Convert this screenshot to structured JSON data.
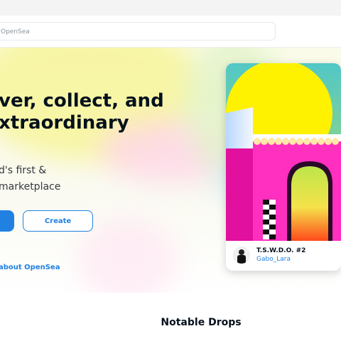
{
  "search": {
    "placeholder": "OpenSea"
  },
  "hero": {
    "title_line1": "ver, collect, and",
    "title_line2": "xtraordinary",
    "subtitle_line1": "d's first &",
    "subtitle_line2": "marketplace",
    "create_label": "Create",
    "learn_more": "about OpenSea"
  },
  "featured": {
    "name": "T.S.W.D.O. #2",
    "creator": "Gabo_Lara"
  },
  "section_title": "Notable Drops",
  "colors": {
    "accent": "#2081e2",
    "text": "#04111d"
  }
}
